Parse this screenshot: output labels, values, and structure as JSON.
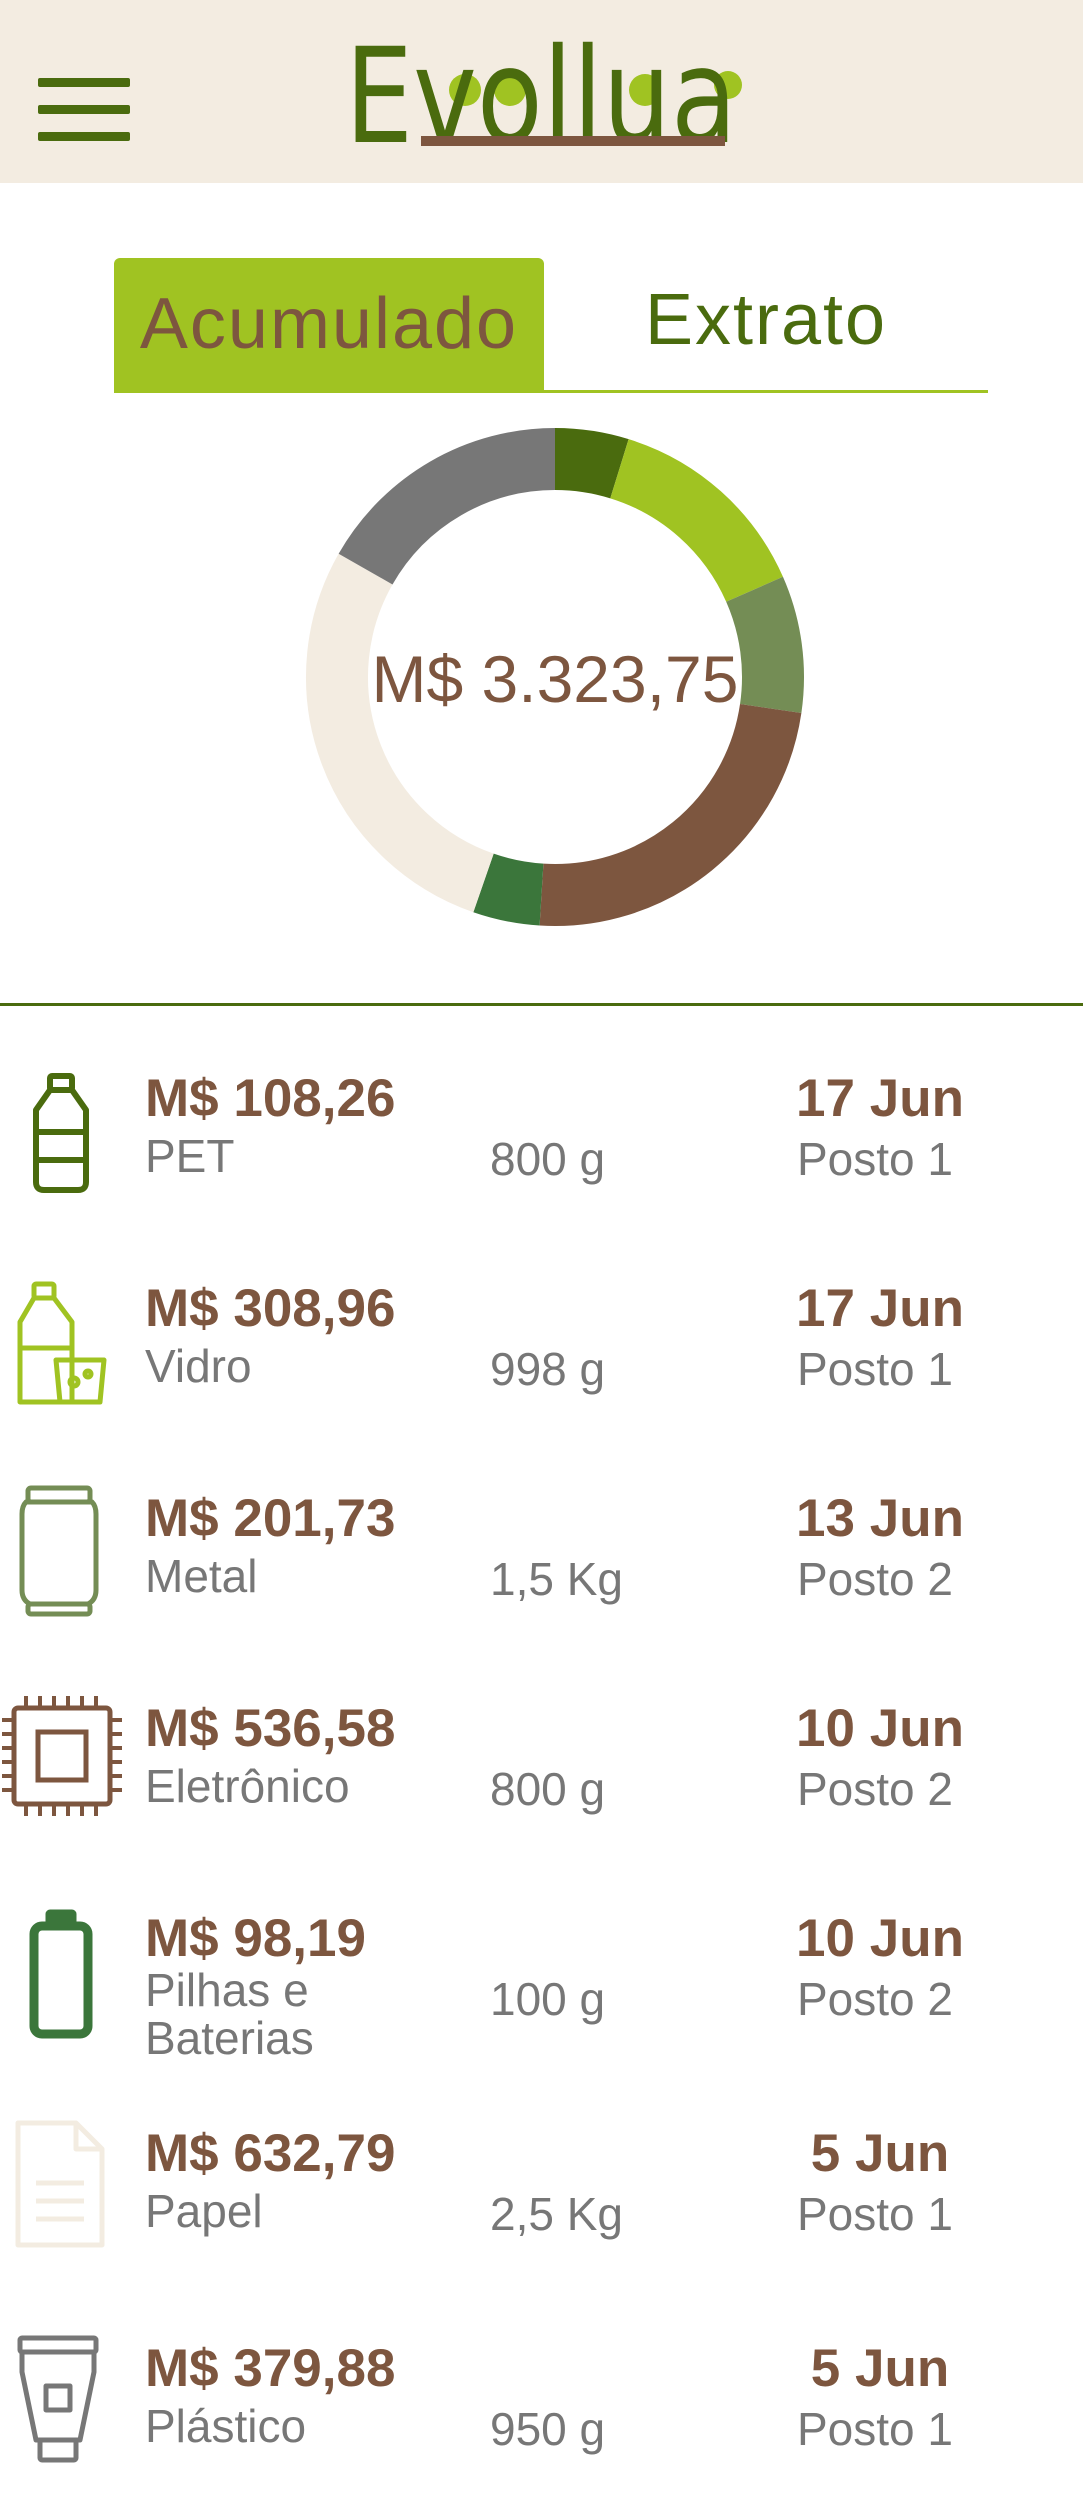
{
  "header": {
    "logo_text": "Evollua",
    "menu_icon": "hamburger-menu-icon"
  },
  "tabs": [
    {
      "label": "Acumulado",
      "active": true
    },
    {
      "label": "Extrato",
      "active": false
    }
  ],
  "summary": {
    "total": "M$ 3.323,75"
  },
  "chart_data": {
    "type": "pie",
    "categories": [
      "PET",
      "Vidro",
      "Metal",
      "Eletrônico",
      "Pilhas e Baterias",
      "Papel",
      "Plástico"
    ],
    "values": [
      108.26,
      308.96,
      201.73,
      536.58,
      98.19,
      632.79,
      379.88
    ],
    "colors": [
      "#4a6b0e",
      "#a0c322",
      "#748d55",
      "#7d563f",
      "#3b763b",
      "#f3ece1",
      "#777777"
    ]
  },
  "colors": {
    "brand_dark_green": "#4a6b0e",
    "brand_light_green": "#a0c322",
    "brand_brown": "#7d563f",
    "header_bg": "#f3ece1",
    "muted_text": "#777777"
  },
  "transactions": [
    {
      "icon": "pet-bottle-icon",
      "amount": "M$ 108,26",
      "material": "PET",
      "weight": "800 g",
      "date": "17 Jun",
      "post": "Posto 1"
    },
    {
      "icon": "glass-bottle-icon",
      "amount": "M$ 308,96",
      "material": "Vidro",
      "weight": "998 g",
      "date": "17 Jun",
      "post": "Posto 1"
    },
    {
      "icon": "metal-can-icon",
      "amount": "M$ 201,73",
      "material": "Metal",
      "weight": "1,5 Kg",
      "date": "13 Jun",
      "post": "Posto 2"
    },
    {
      "icon": "chip-icon",
      "amount": "M$ 536,58",
      "material": "Eletrônico",
      "weight": "800 g",
      "date": "10 Jun",
      "post": "Posto 2"
    },
    {
      "icon": "battery-icon",
      "amount": "M$ 98,19",
      "material": "Pilhas e Baterias",
      "weight": "100 g",
      "date": "10 Jun",
      "post": "Posto 2"
    },
    {
      "icon": "paper-icon",
      "amount": "M$ 632,79",
      "material": "Papel",
      "weight": "2,5 Kg",
      "date": "5 Jun",
      "post": "Posto 1"
    },
    {
      "icon": "plastic-tube-icon",
      "amount": "M$ 379,88",
      "material": "Plástico",
      "weight": "950 g",
      "date": "5 Jun",
      "post": "Posto 1"
    }
  ]
}
